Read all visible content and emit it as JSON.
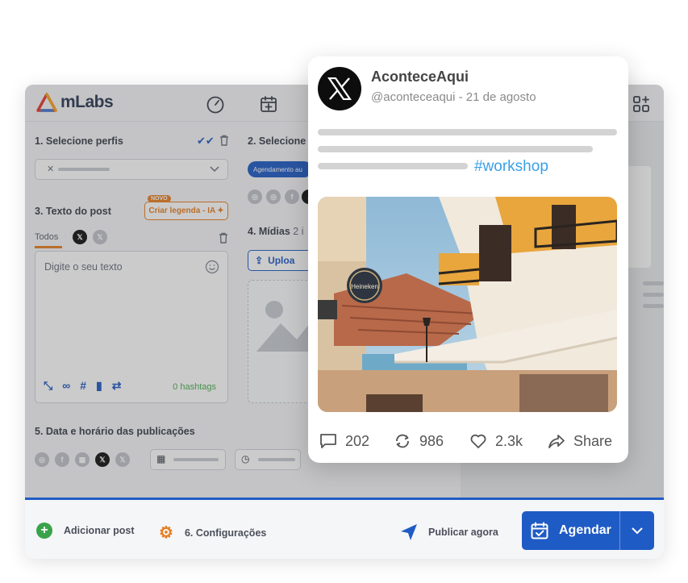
{
  "app": {
    "logo_text": "mLabs",
    "step1_title": "1. Selecione perfis",
    "step2_title": "2. Selecione",
    "step2_chip": "Agendamento au",
    "step3_title": "3. Texto do post",
    "ai_badge_new": "NOVO",
    "ai_button": "Criar legenda - IA",
    "tab_all": "Todos",
    "text_placeholder": "Digite o seu texto",
    "hashtags_count": "0 hashtags",
    "step4_title": "4. Mídias",
    "step4_suffix": "2 i",
    "upload_button": "Uploa",
    "step5_title": "5. Data e horário das publicações"
  },
  "footer": {
    "add_post": "Adicionar post",
    "settings": "6. Configurações",
    "publish_now": "Publicar agora",
    "schedule": "Agendar"
  },
  "post": {
    "author": "AconteceAqui",
    "handle": "@aconteceaqui - 21 de agosto",
    "hashtag": "#workshop",
    "sign_text": "Heineken",
    "replies": "202",
    "retweets": "986",
    "likes": "2.3k",
    "share": "Share"
  },
  "colors": {
    "brand_blue": "#1f5bc5",
    "ai_orange": "#e67e22",
    "hashtag_blue": "#3aa0e6",
    "hashtag_green": "#4caf50"
  }
}
